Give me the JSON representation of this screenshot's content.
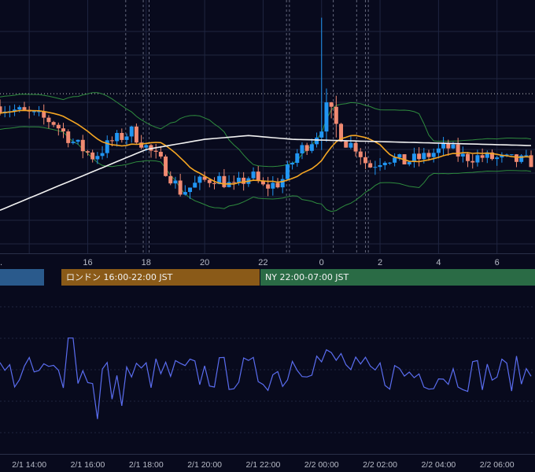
{
  "colors": {
    "background": "#080a1d",
    "grid": "#1f2540",
    "axis_text": "#b8bcc8",
    "up_candle": "#2196f3",
    "down_candle": "#f08a72",
    "ma_fast": "#f5a623",
    "ma_slow": "#f2f2f2",
    "bollinger": "#2e8b3e",
    "oscillator": "#5a6df0",
    "event_line": "#8a8fa5",
    "dotted_level": "#c8c8c8"
  },
  "sessions": [
    {
      "name": "tokyo",
      "label": "",
      "color": "#2a5a8c"
    },
    {
      "name": "london",
      "label": "ロンドン 16:00-22:00 JST",
      "color": "#8a5a18"
    },
    {
      "name": "ny",
      "label": "NY 22:00-07:00 JST",
      "color": "#2a6b45"
    }
  ],
  "chart_data": [
    {
      "type": "candlestick",
      "title": "",
      "x_ticks": [
        "16",
        "18",
        "20",
        "22",
        "0",
        "2",
        "4",
        "6"
      ],
      "x_range_hours": [
        13.0,
        31.3
      ],
      "y_range": [
        0,
        100
      ],
      "grid": true,
      "dotted_level": 63,
      "series": [
        {
          "kind": "candles",
          "interval_minutes": 10
        },
        {
          "kind": "line",
          "role": "moving-average-fast",
          "color": "#f5a623"
        },
        {
          "kind": "line",
          "role": "moving-average-slow",
          "color": "#f2f2f2"
        },
        {
          "kind": "band",
          "role": "bollinger",
          "color": "#2e8b3e"
        }
      ],
      "event_lines_hours": [
        17.3,
        17.9,
        18.1,
        22.8,
        22.9,
        24.4,
        25.2,
        25.5,
        25.6
      ]
    },
    {
      "type": "line",
      "title": "",
      "x_ticks": [
        "2/1 14:00",
        "2/1 16:00",
        "2/1 18:00",
        "2/1 20:00",
        "2/1 22:00",
        "2/2 00:00",
        "2/2 02:00",
        "2/2 04:00",
        "2/2 06:00"
      ],
      "y_range": [
        0,
        100
      ],
      "grid": true,
      "series": [
        {
          "kind": "line",
          "role": "oscillator",
          "color": "#5a6df0"
        }
      ]
    }
  ]
}
